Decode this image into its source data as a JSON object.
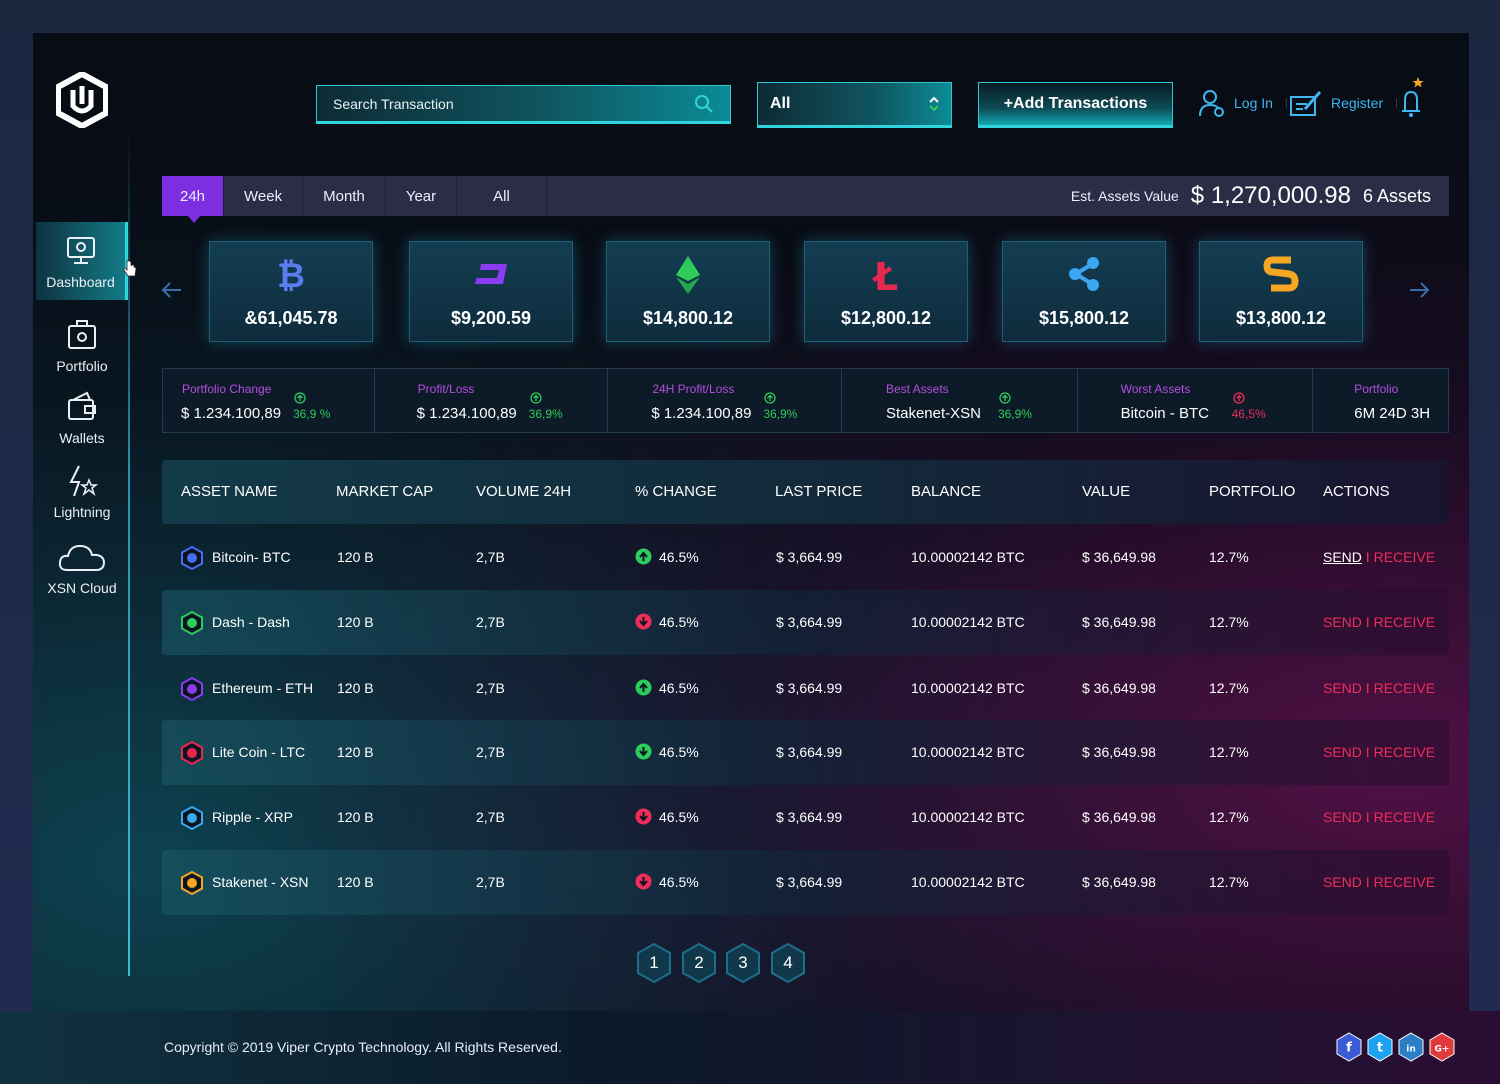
{
  "header": {
    "search": {
      "placeholder": "Search Transaction"
    },
    "filter": {
      "selected": "All"
    },
    "add_button_label": "+Add Transactions",
    "login_label": "Log In",
    "register_label": "Register"
  },
  "sidebar": {
    "items": [
      {
        "label": "Dashboard",
        "icon": "monitor-icon",
        "active": true
      },
      {
        "label": "Portfolio",
        "icon": "portfolio-icon"
      },
      {
        "label": "Wallets",
        "icon": "wallet-icon"
      },
      {
        "label": "Lightning",
        "icon": "lightning-icon"
      },
      {
        "label": "XSN Cloud",
        "icon": "cloud-icon"
      }
    ]
  },
  "time_tabs": [
    "24h",
    "Week",
    "Month",
    "Year",
    "All"
  ],
  "active_tab": "24h",
  "summary": {
    "est_label": "Est. Assets Value",
    "est_value": "$ 1,270,000.98",
    "asset_count": "6 Assets"
  },
  "coin_cards": [
    {
      "coin": "bitcoin",
      "amount": "&61,045.78",
      "color": "#5a7cf0"
    },
    {
      "coin": "dash",
      "amount": "$9,200.59",
      "color": "#8b3cf0"
    },
    {
      "coin": "ethereum",
      "amount": "$14,800.12",
      "color": "#2ecc5a"
    },
    {
      "coin": "litecoin",
      "amount": "$12,800.12",
      "color": "#e8294f"
    },
    {
      "coin": "ripple",
      "amount": "$15,800.12",
      "color": "#3aa7f0"
    },
    {
      "coin": "stakenet",
      "amount": "$13,800.12",
      "color": "#f5a623"
    }
  ],
  "stats": [
    {
      "label": "Portfolio Change",
      "value": "$ 1.234.100,89",
      "pct": "36,9 %",
      "trend": "up"
    },
    {
      "label": "Profit/Loss",
      "value": "$ 1.234.100,89",
      "pct": "36,9%",
      "trend": "up"
    },
    {
      "label": "24H Profit/Loss",
      "value": "$ 1.234.100,89",
      "pct": "36,9%",
      "trend": "up"
    },
    {
      "label": "Best Assets",
      "value": "Stakenet-XSN",
      "pct": "36,9%",
      "trend": "up"
    },
    {
      "label": "Worst Assets",
      "value": "Bitcoin - BTC",
      "pct": "46,5%",
      "trend": "down"
    },
    {
      "label": "Portfolio",
      "value": "6M 24D 3H",
      "pct": "",
      "trend": ""
    }
  ],
  "table": {
    "headers": [
      "ASSET NAME",
      "MARKET CAP",
      "VOLUME 24H",
      "% CHANGE",
      "LAST PRICE",
      "BALANCE",
      "VALUE",
      "PORTFOLIO",
      "ACTIONS"
    ],
    "rows": [
      {
        "name": "Bitcoin- BTC",
        "market_cap": "120 B",
        "volume": "2,7B",
        "change": "46.5%",
        "trend": "up",
        "last_price": "$ 3,664.99",
        "balance": "10.00002142 BTC",
        "value": "$ 36,649.98",
        "portfolio": "12.7%",
        "color": "#4a6cf0"
      },
      {
        "name": "Dash - Dash",
        "market_cap": "120 B",
        "volume": "2,7B",
        "change": "46.5%",
        "trend": "down",
        "last_price": "$ 3,664.99",
        "balance": "10.00002142 BTC",
        "value": "$ 36,649.98",
        "portfolio": "12.7%",
        "color": "#2ecc5a"
      },
      {
        "name": "Ethereum - ETH",
        "market_cap": "120 B",
        "volume": "2,7B",
        "change": "46.5%",
        "trend": "up",
        "last_price": "$ 3,664.99",
        "balance": "10.00002142 BTC",
        "value": "$ 36,649.98",
        "portfolio": "12.7%",
        "color": "#8b3cf0"
      },
      {
        "name": "Lite Coin - LTC",
        "market_cap": "120 B",
        "volume": "2,7B",
        "change": "46.5%",
        "trend": "down-green",
        "last_price": "$ 3,664.99",
        "balance": "10.00002142 BTC",
        "value": "$ 36,649.98",
        "portfolio": "12.7%",
        "color": "#e8294f"
      },
      {
        "name": "Ripple - XRP",
        "market_cap": "120 B",
        "volume": "2,7B",
        "change": "46.5%",
        "trend": "down",
        "last_price": "$ 3,664.99",
        "balance": "10.00002142 BTC",
        "value": "$ 36,649.98",
        "portfolio": "12.7%",
        "color": "#3aa7f0"
      },
      {
        "name": "Stakenet - XSN",
        "market_cap": "120 B",
        "volume": "2,7B",
        "change": "46.5%",
        "trend": "down",
        "last_price": "$ 3,664.99",
        "balance": "10.00002142 BTC",
        "value": "$ 36,649.98",
        "portfolio": "12.7%",
        "color": "#f5a623"
      }
    ],
    "send_label": "SEND",
    "separator": "I",
    "receive_label": "RECEIVE"
  },
  "pagination": [
    "1",
    "2",
    "3",
    "4"
  ],
  "footer": {
    "copyright": "Copyright © 2019 Viper Crypto Technology. All Rights Reserved.",
    "social": [
      {
        "icon": "facebook-icon",
        "glyph": "f",
        "color": "#3b5bd6"
      },
      {
        "icon": "twitter-icon",
        "glyph": "t",
        "color": "#1da1f2"
      },
      {
        "icon": "linkedin-icon",
        "glyph": "in",
        "color": "#2a7fc4"
      },
      {
        "icon": "google-plus-icon",
        "glyph": "G+",
        "color": "#e03a3a"
      }
    ]
  },
  "colors": {
    "accent_cyan": "#2fd4dc",
    "accent_purple": "#7b2fe0",
    "up_green": "#2ecc5a",
    "down_red": "#ee2d5a",
    "label_purple": "#b44ee0"
  }
}
